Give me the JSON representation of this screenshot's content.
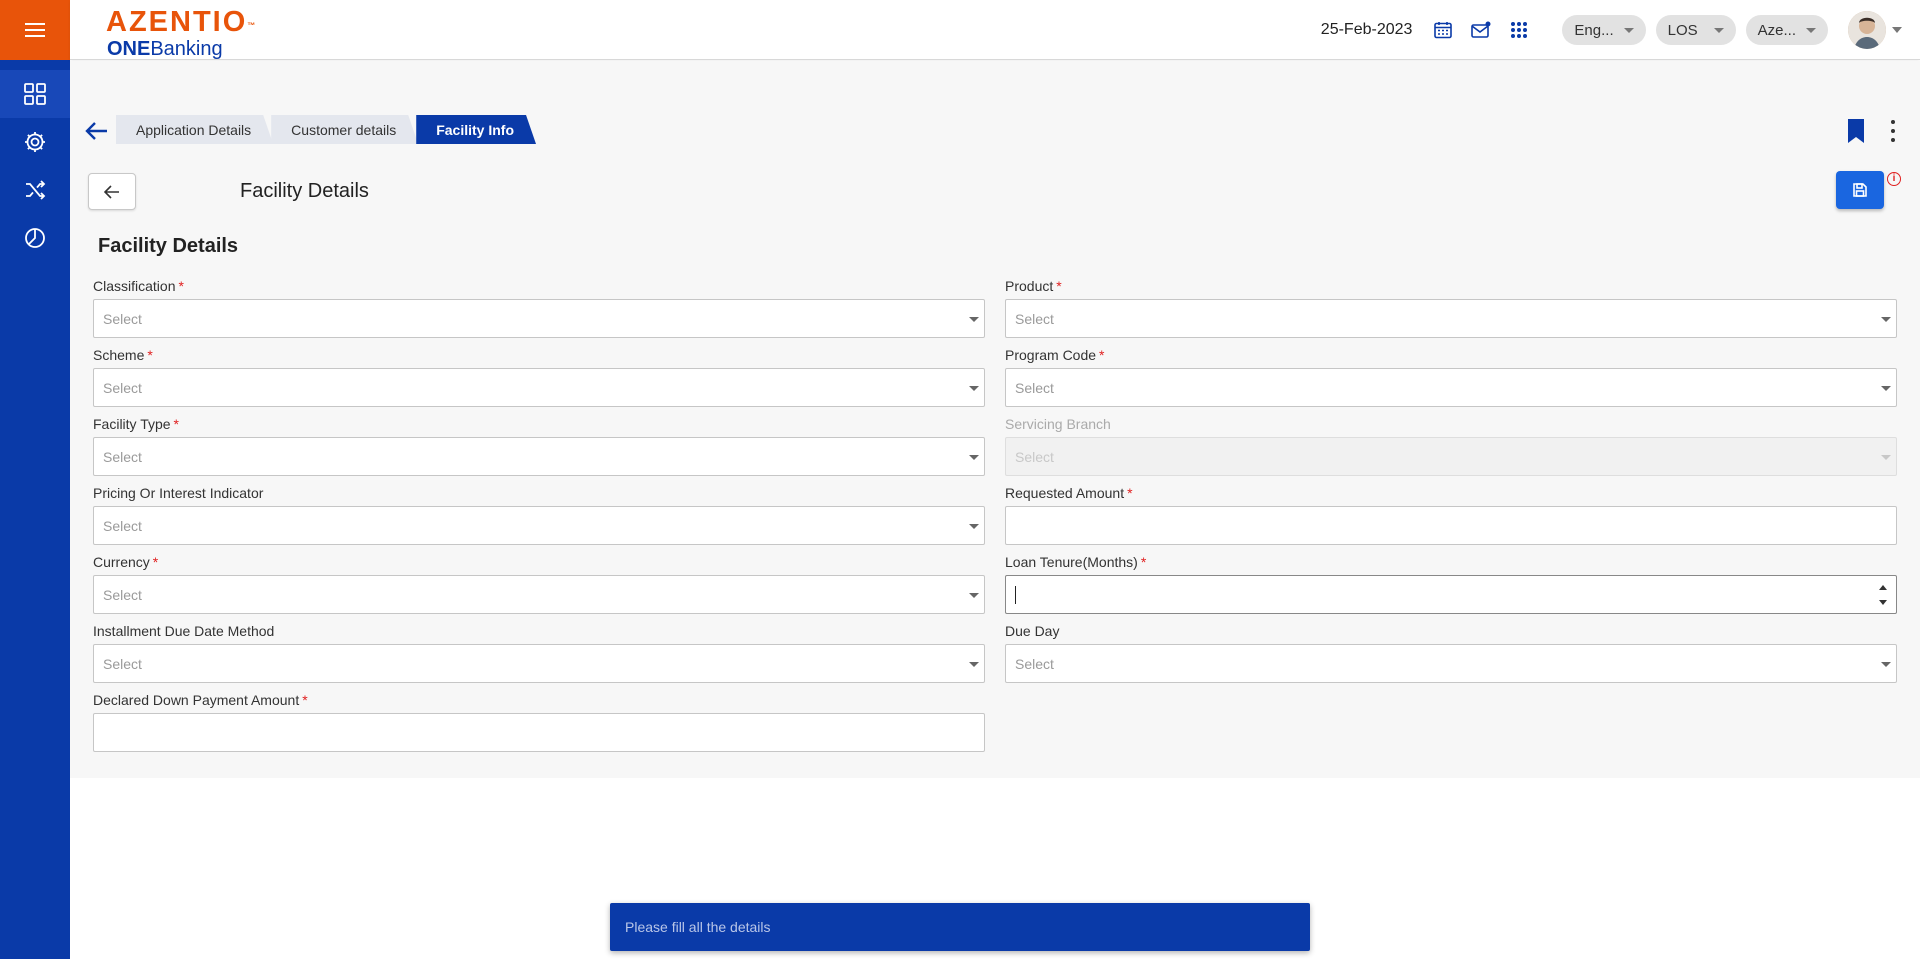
{
  "header": {
    "logo_brand": "AZENTIO",
    "logo_tm": "™",
    "logo_one": "ONE",
    "logo_banking": "Banking",
    "date": "25-Feb-2023",
    "language": "Eng...",
    "module": "LOS",
    "entity": "Aze..."
  },
  "sidebar": {
    "items": [
      {
        "name": "dashboard",
        "icon": "grid-icon"
      },
      {
        "name": "settings",
        "icon": "gear-icon"
      },
      {
        "name": "workflow",
        "icon": "shuffle-icon"
      },
      {
        "name": "reports",
        "icon": "pie-chart-icon"
      }
    ]
  },
  "tabs": [
    {
      "label": "Application Details",
      "active": false
    },
    {
      "label": "Customer details",
      "active": false
    },
    {
      "label": "Facility Info",
      "active": true
    }
  ],
  "section": {
    "title": "Facility Details",
    "form_title": "Facility Details",
    "info_symbol": "i"
  },
  "form": {
    "classification": {
      "label": "Classification",
      "placeholder": "Select"
    },
    "product": {
      "label": "Product",
      "placeholder": "Select"
    },
    "scheme": {
      "label": "Scheme",
      "placeholder": "Select"
    },
    "program_code": {
      "label": "Program Code",
      "placeholder": "Select"
    },
    "facility_type": {
      "label": "Facility Type",
      "placeholder": "Select"
    },
    "servicing_branch": {
      "label": "Servicing Branch",
      "placeholder": "Select"
    },
    "pricing_indicator": {
      "label": "Pricing Or Interest Indicator",
      "placeholder": "Select"
    },
    "requested_amount": {
      "label": "Requested Amount",
      "value": ""
    },
    "currency": {
      "label": "Currency",
      "placeholder": "Select"
    },
    "loan_tenure": {
      "label": "Loan Tenure(Months)",
      "value": ""
    },
    "installment_due_method": {
      "label": "Installment Due Date Method",
      "placeholder": "Select"
    },
    "due_day": {
      "label": "Due Day",
      "placeholder": "Select"
    },
    "down_payment": {
      "label": "Declared Down Payment Amount",
      "value": ""
    },
    "required_marker": "*"
  },
  "toast": {
    "message": "Please fill all the details"
  },
  "colors": {
    "brand_blue": "#0a3aa8",
    "brand_orange": "#e8540a",
    "required_red": "#e02020",
    "save_blue": "#1a66e0"
  }
}
